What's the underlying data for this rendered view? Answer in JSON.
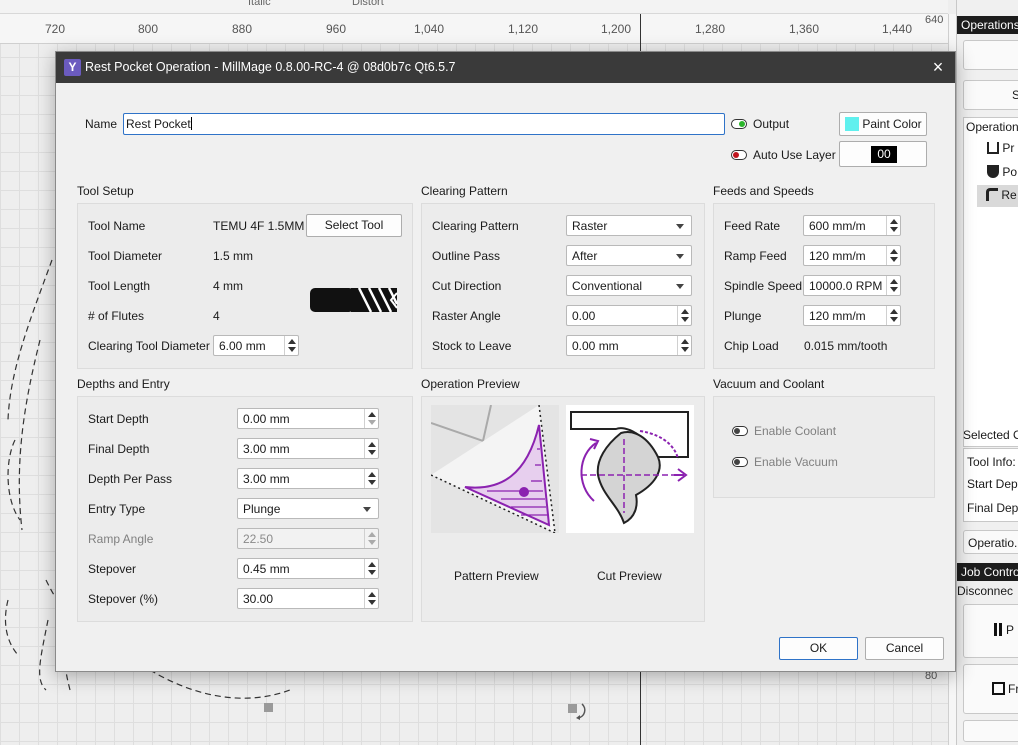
{
  "background": {
    "top_strip": {
      "italic": "Italic",
      "distort": "Distort"
    },
    "ruler_ticks": [
      "720",
      "800",
      "880",
      "960",
      "1,040",
      "1,120",
      "1,200",
      "1,280",
      "1,360",
      "1,440"
    ],
    "right_ruler": {
      "top": "640",
      "bottom": "80"
    }
  },
  "right_panel": {
    "operations_header": "Operations",
    "se_btn": "Se",
    "operation_header": "Operation",
    "op_items": [
      "Pr",
      "Po",
      "Re"
    ],
    "selected_op": "Selected O",
    "tool_info": "Tool Info:",
    "start_depth": "Start Dept",
    "final_depth": "Final Dept",
    "operation_btn": "Operatio...",
    "job_control": "Job Contro",
    "disconnected": "Disconnec",
    "pause_label": "P",
    "frame_label": "Fr"
  },
  "dialog": {
    "title": "Rest Pocket Operation - MillMage 0.8.00-RC-4 @ 08d0b7c Qt6.5.7",
    "app_icon": "Y",
    "close_icon": "×",
    "name_label": "Name",
    "name_value": "Rest Pocket",
    "output_label": "Output",
    "auto_use_layer_label": "Auto Use Layer",
    "paint_color_label": "Paint Color",
    "paint_color": "#5ff0ee",
    "layer_value": "00",
    "tool_setup": {
      "title": "Tool Setup",
      "tool_name_label": "Tool Name",
      "tool_name": "TEMU 4F 1.5MM",
      "select_tool": "Select Tool",
      "diameter_label": "Tool Diameter",
      "diameter": "1.5 mm",
      "length_label": "Tool Length",
      "length": "4 mm",
      "flutes_label": "# of Flutes",
      "flutes": "4",
      "clearing_diameter_label": "Clearing Tool Diameter",
      "clearing_diameter": "6.00 mm"
    },
    "clearing_pattern": {
      "title": "Clearing Pattern",
      "pattern_label": "Clearing Pattern",
      "pattern": "Raster",
      "outline_label": "Outline Pass",
      "outline": "After",
      "cut_dir_label": "Cut Direction",
      "cut_dir": "Conventional",
      "raster_angle_label": "Raster Angle",
      "raster_angle": "0.00",
      "stock_label": "Stock to Leave",
      "stock": "0.00 mm"
    },
    "feeds": {
      "title": "Feeds and Speeds",
      "feed_rate_label": "Feed Rate",
      "feed_rate": "600 mm/m",
      "ramp_feed_label": "Ramp Feed",
      "ramp_feed": "120 mm/m",
      "spindle_label": "Spindle Speed",
      "spindle": "10000.0 RPM",
      "plunge_label": "Plunge",
      "plunge": "120 mm/m",
      "chip_load_label": "Chip Load",
      "chip_load": "0.015 mm/tooth"
    },
    "depths": {
      "title": "Depths and Entry",
      "start_label": "Start Depth",
      "start": "0.00 mm",
      "final_label": "Final Depth",
      "final": "3.00 mm",
      "per_pass_label": "Depth Per Pass",
      "per_pass": "3.00 mm",
      "entry_label": "Entry Type",
      "entry": "Plunge",
      "ramp_angle_label": "Ramp Angle",
      "ramp_angle": "22.50",
      "stepover_label": "Stepover",
      "stepover": "0.45 mm",
      "stepover_pct_label": "Stepover (%)",
      "stepover_pct": "30.00"
    },
    "preview": {
      "title": "Operation Preview",
      "pattern_caption": "Pattern Preview",
      "cut_caption": "Cut Preview"
    },
    "vacuum": {
      "title": "Vacuum and Coolant",
      "coolant": "Enable Coolant",
      "vacuum": "Enable Vacuum"
    },
    "ok": "OK",
    "cancel": "Cancel"
  }
}
